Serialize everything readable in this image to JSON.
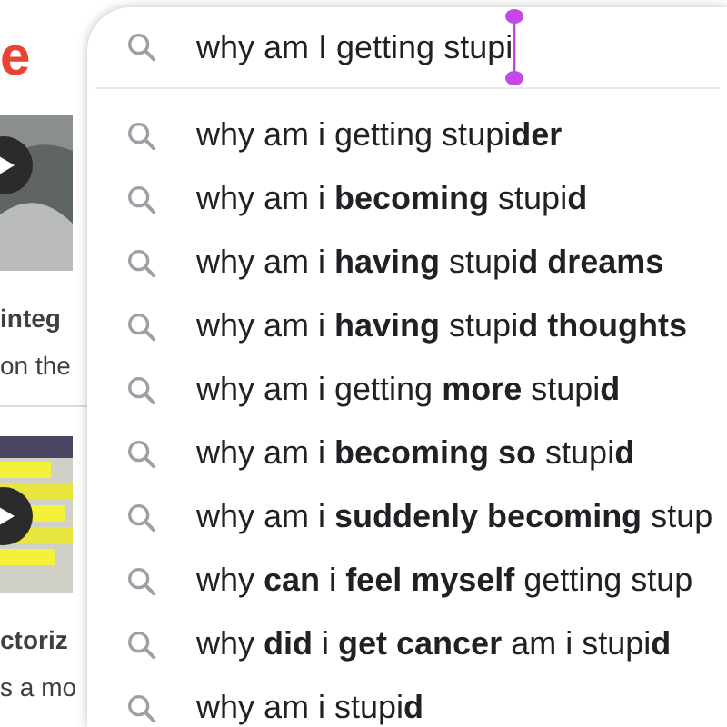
{
  "background": {
    "logo_fragment": "e",
    "snippets": [
      {
        "kind": "video",
        "lines": [
          {
            "text": "integ",
            "bold": true
          },
          {
            "text": "on the",
            "bold": false
          }
        ]
      },
      {
        "kind": "video",
        "lines": [
          {
            "text": "ctoriz",
            "bold": true
          },
          {
            "text": "s a mo",
            "bold": false
          }
        ]
      }
    ]
  },
  "search": {
    "value": "why am I getting stupi"
  },
  "suggestions": [
    {
      "text": "why am i getting stupi**der**"
    },
    {
      "text": "why am i **becoming** stupi**d**"
    },
    {
      "text": "why am i **having** stupi**d dreams**"
    },
    {
      "text": "why am i **having** stupi**d thoughts**"
    },
    {
      "text": "why am i getting **more** stupi**d**"
    },
    {
      "text": "why am i **becoming so** stupi**d**"
    },
    {
      "text": "why am i **suddenly becoming** stup"
    },
    {
      "text": "why **can** i **feel myself** getting stup"
    },
    {
      "text": "why **did** i **get cancer** am i stupi**d**"
    },
    {
      "text": "why am i stupi**d**"
    }
  ]
}
